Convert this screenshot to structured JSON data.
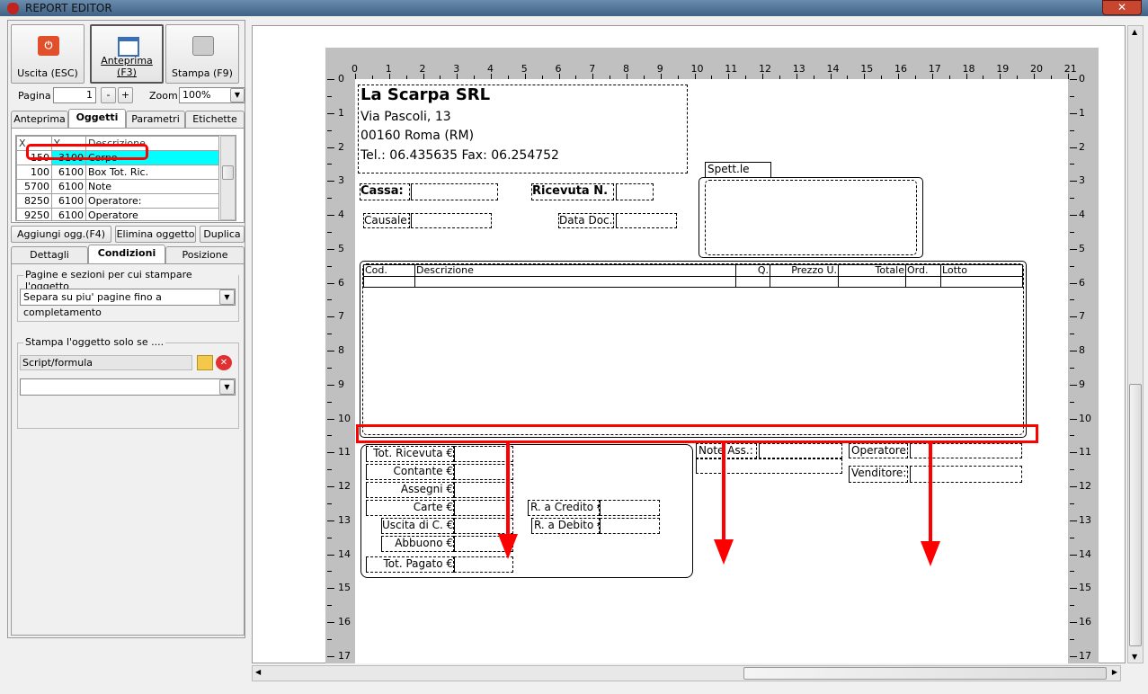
{
  "window": {
    "title": "REPORT EDITOR",
    "close": "✕"
  },
  "toolbar": {
    "exit": "Uscita (ESC)",
    "preview": "Anteprima (F3)",
    "print": "Stampa (F9)",
    "page_label": "Pagina",
    "page_value": "1",
    "minus": "-",
    "plus": "+",
    "zoom_label": "Zoom",
    "zoom_value": "100%"
  },
  "tabs_top": [
    "Anteprima",
    "Oggetti",
    "Parametri",
    "Etichette"
  ],
  "objects": {
    "headers": [
      "X",
      "Y",
      "Descrizione"
    ],
    "rows": [
      [
        "150",
        "3100",
        "Corpo"
      ],
      [
        "100",
        "6100",
        "Box Tot. Ric."
      ],
      [
        "5700",
        "6100",
        "Note"
      ],
      [
        "8250",
        "6100",
        "Operatore:"
      ],
      [
        "9250",
        "6100",
        "Operatore"
      ]
    ],
    "selected": 0
  },
  "object_buttons": [
    "Aggiungi ogg.(F4)",
    "Elimina oggetto",
    "Duplica"
  ],
  "tabs_bottom": [
    "Dettagli",
    "Condizioni",
    "Posizione"
  ],
  "conditions": {
    "pages_group": "Pagine e sezioni per cui stampare l'oggetto",
    "pages_value": "Separa su piu' pagine fino a completamento",
    "print_if_group": "Stampa l'oggetto solo se ....",
    "script_value": "Script/formula",
    "condition_value": ""
  },
  "ruler": {
    "h": [
      "0",
      "1",
      "2",
      "3",
      "4",
      "5",
      "6",
      "7",
      "8",
      "9",
      "10",
      "11",
      "12",
      "13",
      "14",
      "15",
      "16",
      "17",
      "18",
      "19",
      "20",
      "21"
    ],
    "v": [
      "0",
      "1",
      "2",
      "3",
      "4",
      "5",
      "6",
      "7",
      "8",
      "9",
      "10",
      "11",
      "12",
      "13",
      "14",
      "15",
      "16",
      "17"
    ]
  },
  "doc": {
    "company": "La Scarpa SRL",
    "address": "Via Pascoli, 13",
    "city": "00160 Roma (RM)",
    "phone": "Tel.: 06.435635 Fax: 06.254752",
    "cassa": "Cassa:",
    "ricevuta": "Ricevuta N.",
    "causale": "Causale:",
    "data_doc": "Data Doc.",
    "spett": "Spett.le",
    "columns": [
      "Cod.",
      "Descrizione",
      "Q.",
      "Prezzo U.",
      "Totale",
      "Ord.",
      "Lotto"
    ],
    "totals": [
      "Tot. Ricevuta €",
      "Contante €",
      "Assegni €",
      "Carte €",
      "Uscita di C. €",
      "Abbuono €",
      "Tot. Pagato €"
    ],
    "credito": "R. a Credito €",
    "debito": "R. a Debito €",
    "note": "Note Ass.:",
    "operatore": "Operatore:",
    "venditore": "Venditore:"
  },
  "colors": {
    "highlight": "#00ffff",
    "annotation": "#ff0000"
  }
}
